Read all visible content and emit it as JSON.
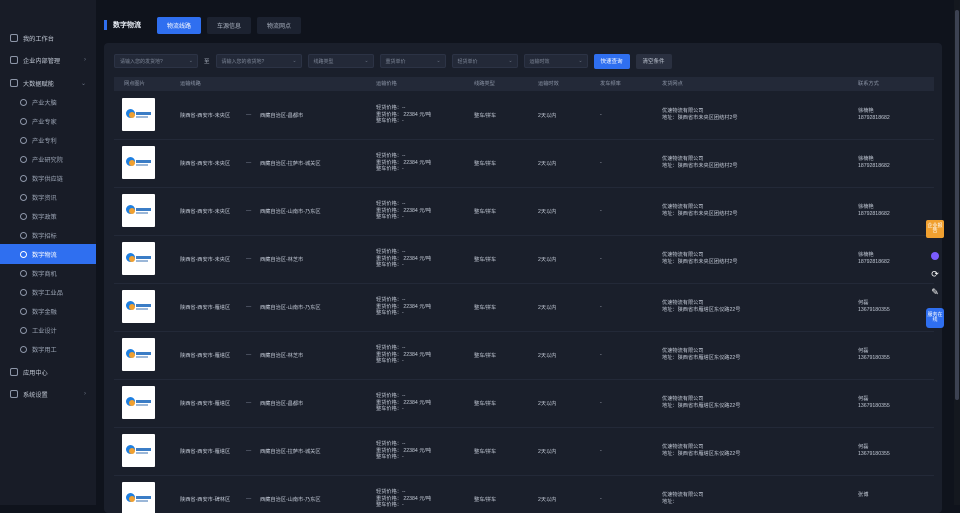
{
  "sidebar": {
    "items": [
      {
        "label": "我的工作台",
        "arrow": ""
      },
      {
        "label": "企业内部管理",
        "arrow": "›"
      },
      {
        "label": "大数据赋能",
        "arrow": "⌄"
      },
      {
        "label": "产业大脑",
        "arrow": ""
      },
      {
        "label": "产业专家",
        "arrow": ""
      },
      {
        "label": "产业专利",
        "arrow": ""
      },
      {
        "label": "产业研究院",
        "arrow": ""
      },
      {
        "label": "数字供应链",
        "arrow": ""
      },
      {
        "label": "数字资讯",
        "arrow": ""
      },
      {
        "label": "数字政策",
        "arrow": ""
      },
      {
        "label": "数字招标",
        "arrow": ""
      },
      {
        "label": "数字物流",
        "arrow": ""
      },
      {
        "label": "数字商机",
        "arrow": ""
      },
      {
        "label": "数字工业品",
        "arrow": ""
      },
      {
        "label": "数字金融",
        "arrow": ""
      },
      {
        "label": "工业设计",
        "arrow": ""
      },
      {
        "label": "数字用工",
        "arrow": ""
      },
      {
        "label": "应用中心",
        "arrow": ""
      },
      {
        "label": "系统设置",
        "arrow": "›"
      }
    ]
  },
  "header": {
    "title": "数字物流",
    "tabs": [
      "物流线路",
      "车源信息",
      "物流网点"
    ]
  },
  "filters": {
    "origin_placeholder": "请输入您的发货地?",
    "to_label": "至",
    "dest_placeholder": "请输入您的收货地?",
    "route_type": "线路类型",
    "heavy_price": "重货单价",
    "light_price": "轻货单价",
    "transit_time": "运输时效",
    "search_button": "快速查询",
    "clear_button": "清空条件"
  },
  "table": {
    "headers": [
      "网点图片",
      "运输线路",
      "运输价格",
      "线路类型",
      "运输时效",
      "发车频率",
      "发货网点",
      "联系方式"
    ],
    "rows": [
      {
        "route_from": "陕西省-西安市-未央区",
        "route_to": "西藏自治区-昌都市",
        "light": "轻货价格：--",
        "heavy": "重货价格： 22384 元/吨",
        "whole": "整车价格：-",
        "type": "整车/拼车",
        "time": "2天以内",
        "freq": "-",
        "company": "优速物流有限公司",
        "address": "地址：陕西省市未央区团结村2号",
        "contact": "徐楠艳",
        "phone": "18792818682"
      },
      {
        "route_from": "陕西省-西安市-未央区",
        "route_to": "西藏自治区-拉萨市-城关区",
        "light": "轻货价格：--",
        "heavy": "重货价格： 22384 元/吨",
        "whole": "整车价格：-",
        "type": "整车/拼车",
        "time": "2天以内",
        "freq": "-",
        "company": "优速物流有限公司",
        "address": "地址：陕西省市未央区团结村2号",
        "contact": "徐楠艳",
        "phone": "18792818682"
      },
      {
        "route_from": "陕西省-西安市-未央区",
        "route_to": "西藏自治区-山南市-乃东区",
        "light": "轻货价格：--",
        "heavy": "重货价格： 22384 元/吨",
        "whole": "整车价格：-",
        "type": "整车/拼车",
        "time": "2天以内",
        "freq": "-",
        "company": "优速物流有限公司",
        "address": "地址：陕西省市未央区团结村2号",
        "contact": "徐楠艳",
        "phone": "18792818682"
      },
      {
        "route_from": "陕西省-西安市-未央区",
        "route_to": "西藏自治区-林芝市",
        "light": "轻货价格：--",
        "heavy": "重货价格： 22384 元/吨",
        "whole": "整车价格：-",
        "type": "整车/拼车",
        "time": "2天以内",
        "freq": "-",
        "company": "优速物流有限公司",
        "address": "地址：陕西省市未央区团结村2号",
        "contact": "徐楠艳",
        "phone": "18792818682"
      },
      {
        "route_from": "陕西省-西安市-雁塔区",
        "route_to": "西藏自治区-山南市-乃东区",
        "light": "轻货价格：--",
        "heavy": "重货价格： 22384 元/吨",
        "whole": "整车价格：-",
        "type": "整车/拼车",
        "time": "2天以内",
        "freq": "-",
        "company": "优速物流有限公司",
        "address": "地址：陕西省市雁塔区东仪路22号",
        "contact": "何磊",
        "phone": "13679180355"
      },
      {
        "route_from": "陕西省-西安市-雁塔区",
        "route_to": "西藏自治区-林芝市",
        "light": "轻货价格：--",
        "heavy": "重货价格： 22384 元/吨",
        "whole": "整车价格：-",
        "type": "整车/拼车",
        "time": "2天以内",
        "freq": "-",
        "company": "优速物流有限公司",
        "address": "地址：陕西省市雁塔区东仪路22号",
        "contact": "何磊",
        "phone": "13679180355"
      },
      {
        "route_from": "陕西省-西安市-雁塔区",
        "route_to": "西藏自治区-昌都市",
        "light": "轻货价格：--",
        "heavy": "重货价格： 22384 元/吨",
        "whole": "整车价格：-",
        "type": "整车/拼车",
        "time": "2天以内",
        "freq": "-",
        "company": "优速物流有限公司",
        "address": "地址：陕西省市雁塔区东仪路22号",
        "contact": "何磊",
        "phone": "13679180355"
      },
      {
        "route_from": "陕西省-西安市-雁塔区",
        "route_to": "西藏自治区-拉萨市-城关区",
        "light": "轻货价格：--",
        "heavy": "重货价格： 22384 元/吨",
        "whole": "整车价格：-",
        "type": "整车/拼车",
        "time": "2天以内",
        "freq": "-",
        "company": "优速物流有限公司",
        "address": "地址：陕西省市雁塔区东仪路22号",
        "contact": "何磊",
        "phone": "13679180355"
      },
      {
        "route_from": "陕西省-西安市-碑林区",
        "route_to": "西藏自治区-山南市-乃东区",
        "light": "轻货价格：--",
        "heavy": "重货价格： 22384 元/吨",
        "whole": "整车价格：-",
        "type": "整车/拼车",
        "time": "2天以内",
        "freq": "-",
        "company": "优速物流有限公司",
        "address": "地址：",
        "contact": "张博",
        "phone": ""
      }
    ]
  },
  "tools": {
    "report_label": "企业报告",
    "kefu_label": "服务在线"
  },
  "colors": {
    "accent": "#2f6ff0",
    "sidebar_bg": "#181c27",
    "panel_bg": "#1a1f2b"
  }
}
